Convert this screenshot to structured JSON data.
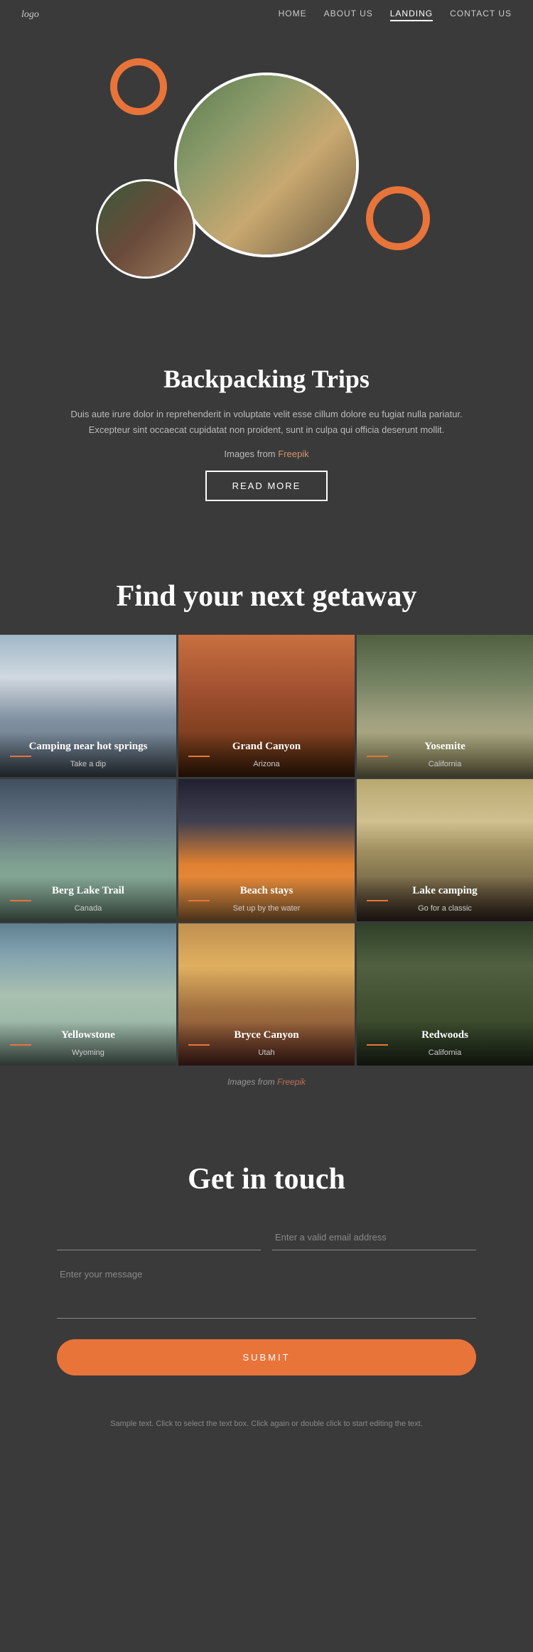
{
  "header": {
    "logo": "logo",
    "nav": [
      {
        "label": "HOME",
        "href": "#",
        "active": false
      },
      {
        "label": "ABOUT US",
        "href": "#",
        "active": false
      },
      {
        "label": "LANDING",
        "href": "#",
        "active": true
      },
      {
        "label": "CONTACT US",
        "href": "#",
        "active": false
      }
    ]
  },
  "hero": {
    "title": "Backpacking Trips"
  },
  "backpacking": {
    "title": "Backpacking Trips",
    "description": "Duis aute irure dolor in reprehenderit in voluptate velit esse cillum dolore eu fugiat nulla pariatur. Excepteur sint occaecat cupidatat non proident, sunt in culpa qui officia deserunt mollit.",
    "images_credit": "Images from",
    "images_link_text": "Freepik",
    "read_more": "READ MORE"
  },
  "getaway": {
    "title": "Find your next getaway",
    "destinations": [
      {
        "title": "Camping near hot springs",
        "subtitle": "Take a dip",
        "bg": "hotsprings"
      },
      {
        "title": "Grand Canyon",
        "subtitle": "Arizona",
        "bg": "grandcanyon"
      },
      {
        "title": "Yosemite",
        "subtitle": "California",
        "bg": "yosemite"
      },
      {
        "title": "Berg Lake Trail",
        "subtitle": "Canada",
        "bg": "berglake"
      },
      {
        "title": "Beach stays",
        "subtitle": "Set up by the water",
        "bg": "beachstays"
      },
      {
        "title": "Lake camping",
        "subtitle": "Go for a classic",
        "bg": "lakecamping"
      },
      {
        "title": "Yellowstone",
        "subtitle": "Wyoming",
        "bg": "yellowstone"
      },
      {
        "title": "Bryce Canyon",
        "subtitle": "Utah",
        "bg": "brycecanyon"
      },
      {
        "title": "Redwoods",
        "subtitle": "California",
        "bg": "redwoods"
      }
    ],
    "images_credit": "Images from",
    "images_link_text": "Freepik"
  },
  "contact": {
    "title": "Get in touch",
    "name_placeholder": "",
    "email_placeholder": "Enter a valid email address",
    "message_placeholder": "Enter your message",
    "submit_label": "SUBMIT"
  },
  "footer": {
    "note": "Sample text. Click to select the text box. Click again or double click to start editing the text."
  }
}
